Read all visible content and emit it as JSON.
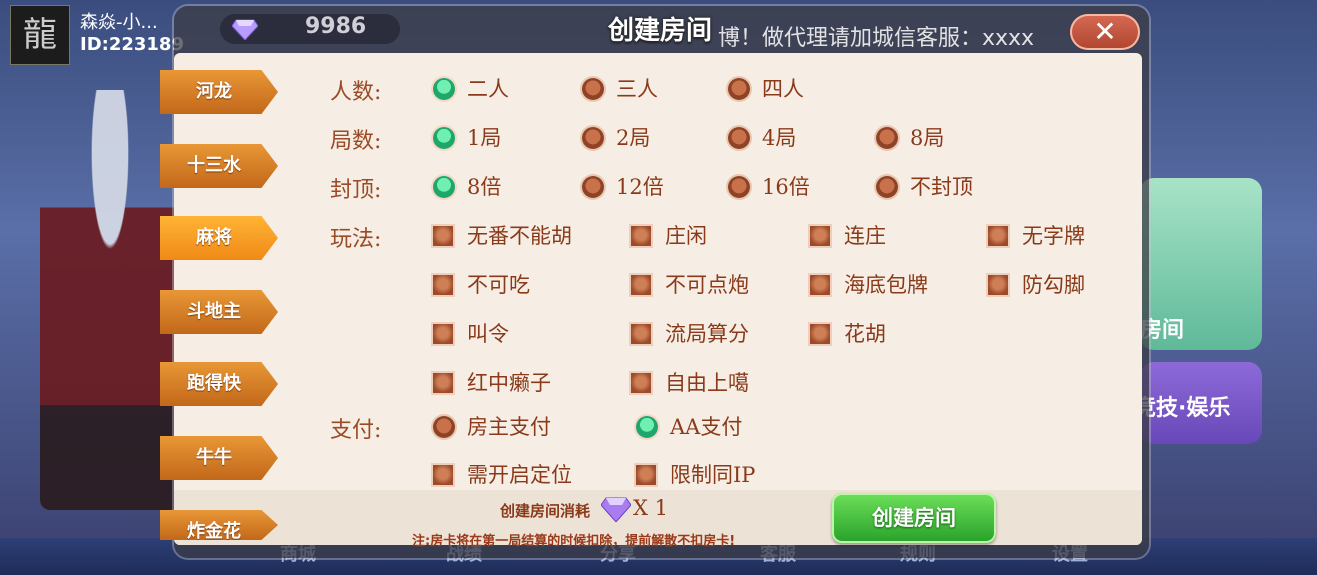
{
  "user": {
    "avatar_char": "龍",
    "name": "森焱-小...",
    "id": "ID:223189"
  },
  "header": {
    "diamond_count": "9986",
    "title": "创建房间",
    "marquee": "博！做代理请加城信客服：xxxx",
    "close_label": "✕"
  },
  "background": {
    "right_label_1": "房间",
    "right_label_2": "竞技·娱乐",
    "bottom_items": [
      "商城",
      "战绩",
      "分享",
      "客服",
      "规则",
      "设置"
    ]
  },
  "tabs": [
    "河龙",
    "十三水",
    "麻将",
    "斗地主",
    "跑得快",
    "牛牛",
    "炸金花"
  ],
  "active_tab": "麻将",
  "form": {
    "players": {
      "label": "人数:",
      "options": [
        "二人",
        "三人",
        "四人"
      ],
      "selected": "二人"
    },
    "rounds": {
      "label": "局数:",
      "options": [
        "1局",
        "2局",
        "4局",
        "8局"
      ],
      "selected": "1局"
    },
    "cap": {
      "label": "封顶:",
      "options": [
        "8倍",
        "12倍",
        "16倍",
        "不封顶"
      ],
      "selected": "8倍"
    },
    "rules": {
      "label": "玩法:",
      "options": [
        "无番不能胡",
        "庄闲",
        "连庄",
        "无字牌",
        "不可吃",
        "不可点炮",
        "海底包牌",
        "防勾脚",
        "叫令",
        "流局算分",
        "花胡",
        "红中癞子",
        "自由上噶"
      ]
    },
    "payment": {
      "label": "支付:",
      "options": [
        "房主支付",
        "AA支付"
      ],
      "selected": "AA支付"
    },
    "extras": {
      "options": [
        "需开启定位",
        "限制同IP"
      ]
    }
  },
  "footer": {
    "cost_label": "创建房间消耗",
    "cost_value": "X 1",
    "note": "注:房卡将在第一局结算的时候扣除，提前解散不扣房卡!",
    "create_label": "创建房间"
  },
  "colors": {
    "accent": "#f08a17",
    "radio_on": "#1ea66d",
    "text": "#8a3a1a",
    "create": "#28a12a"
  }
}
